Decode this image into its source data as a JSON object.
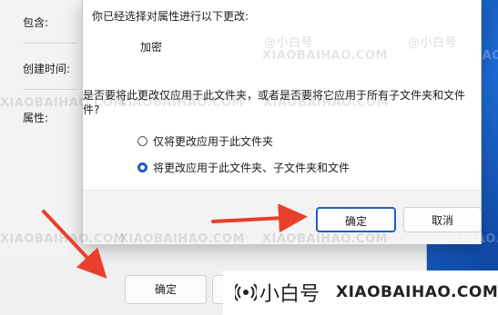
{
  "properties_window": {
    "labels": {
      "contains": "包含:",
      "created": "创建时间:",
      "attributes": "属性:"
    },
    "ok_button": "确定"
  },
  "dialog": {
    "header": "你已经选择对属性进行以下更改:",
    "change": "加密",
    "question_line1": "是否要将此更改仅应用于此文件夹，或者是否要将它应用于所有子文件夹和文件",
    "question_line2": "件?",
    "options": [
      {
        "label": "仅将更改应用于此文件夹",
        "selected": false
      },
      {
        "label": "将更改应用于此文件夹、子文件夹和文件",
        "selected": true
      }
    ],
    "ok_button": "确定",
    "cancel_button": "取消"
  },
  "watermark": {
    "cn": "@小白号",
    "en": "XIAOBAIHAO.COM",
    "bar_cn": "小白号",
    "bar_en": "XIAOBAIHAO.COM"
  },
  "colors": {
    "accent": "#1f5fbf",
    "arrow": "#e8402c"
  }
}
